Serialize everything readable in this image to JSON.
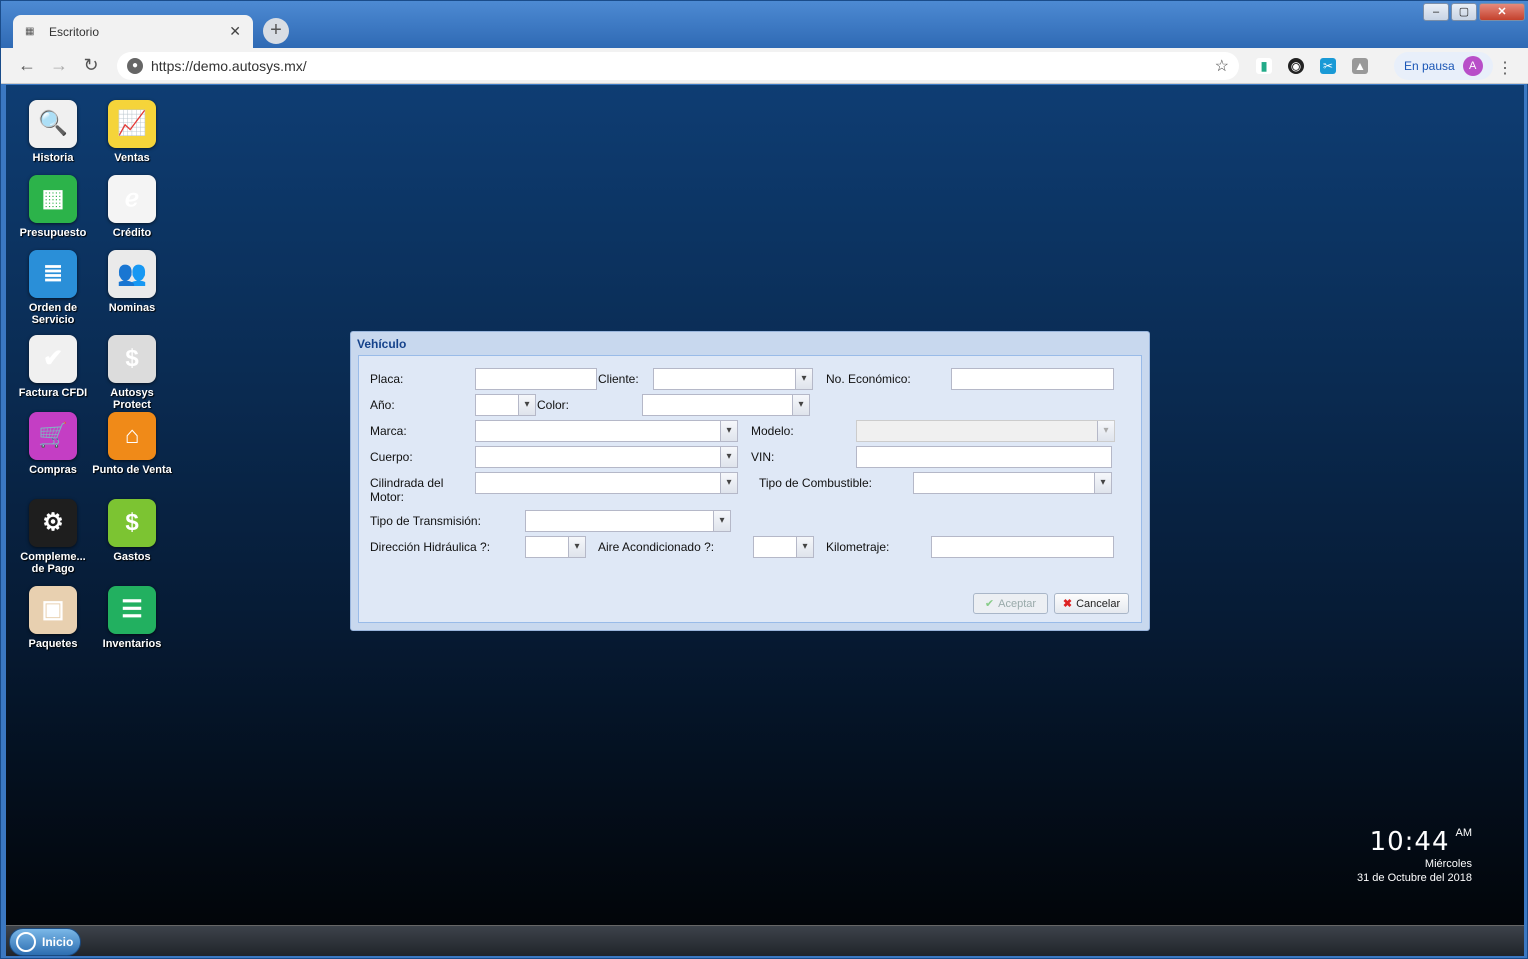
{
  "browser": {
    "tab_title": "Escritorio",
    "url": "https://demo.autosys.mx/",
    "profile_status": "En pausa",
    "profile_initial": "A"
  },
  "desktop_icons": [
    {
      "label": "Historia",
      "icon": "search-icon",
      "color": "#f0f0f0"
    },
    {
      "label": "Ventas",
      "icon": "line-chart-icon",
      "color": "#f5d43a"
    },
    {
      "label": "Presupuesto",
      "icon": "spreadsheet-icon",
      "color": "#2cb34a"
    },
    {
      "label": "Crédito",
      "icon": "credit-logo-icon",
      "color": "#f4f4f4"
    },
    {
      "label": "Orden de Servicio",
      "icon": "document-icon",
      "color": "#2a8fd8"
    },
    {
      "label": "Nominas",
      "icon": "payroll-icon",
      "color": "#eaeaea"
    },
    {
      "label": "Factura CFDI",
      "icon": "xml-invoice-icon",
      "color": "#f0f0f0"
    },
    {
      "label": "Autosys Protect",
      "icon": "thief-icon",
      "color": "#dcdcdc"
    },
    {
      "label": "Compras",
      "icon": "cart-icon",
      "color": "#c43ec4"
    },
    {
      "label": "Punto de Venta",
      "icon": "store-icon",
      "color": "#f08a18"
    },
    {
      "label": "Compleme... de Pago",
      "icon": "steam-icon",
      "color": "#1e1e1e"
    },
    {
      "label": "Gastos",
      "icon": "coins-icon",
      "color": "#7cc432"
    },
    {
      "label": "Paquetes",
      "icon": "box-icon",
      "color": "#e8d0b0"
    },
    {
      "label": "Inventarios",
      "icon": "list-icon",
      "color": "#22b060"
    }
  ],
  "dialog": {
    "title": "Vehículo",
    "labels": {
      "placa": "Placa:",
      "cliente": "Cliente:",
      "no_economico": "No. Económico:",
      "anio": "Año:",
      "color": "Color:",
      "marca": "Marca:",
      "modelo": "Modelo:",
      "cuerpo": "Cuerpo:",
      "vin": "VIN:",
      "cilindrada_1": "Cilindrada del",
      "cilindrada_2": "Motor:",
      "combustible": "Tipo de Combustible:",
      "transmision": "Tipo de Transmisión:",
      "direccion": "Dirección Hidráulica ?:",
      "aire": "Aire Acondicionado ?:",
      "kilometraje": "Kilometraje:"
    },
    "buttons": {
      "accept": "Aceptar",
      "cancel": "Cancelar"
    }
  },
  "clock": {
    "time": "10:44",
    "ampm": "AM",
    "day": "Miércoles",
    "date": "31 de Octubre del 2018"
  },
  "taskbar": {
    "start_label": "Inicio"
  }
}
